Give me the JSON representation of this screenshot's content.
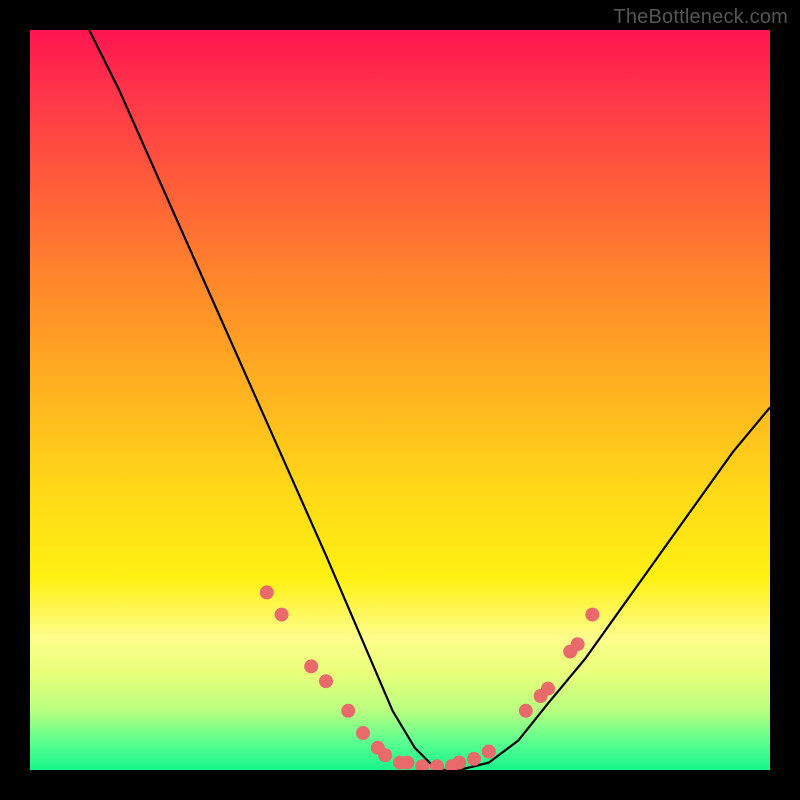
{
  "watermark": "TheBottleneck.com",
  "chart_data": {
    "type": "line",
    "title": "",
    "xlabel": "",
    "ylabel": "",
    "xlim": [
      0,
      100
    ],
    "ylim": [
      0,
      100
    ],
    "series": [
      {
        "name": "curve",
        "x": [
          8,
          12,
          16,
          20,
          24,
          28,
          32,
          36,
          40,
          43,
          46,
          49,
          52,
          55,
          58,
          62,
          66,
          70,
          75,
          80,
          85,
          90,
          95,
          100
        ],
        "y": [
          100,
          92,
          83,
          74,
          65,
          56,
          47,
          38,
          29,
          22,
          15,
          8,
          3,
          0,
          0,
          1,
          4,
          9,
          15,
          22,
          29,
          36,
          43,
          49
        ]
      }
    ],
    "markers": [
      {
        "x": 32,
        "y": 24
      },
      {
        "x": 34,
        "y": 21
      },
      {
        "x": 38,
        "y": 14
      },
      {
        "x": 40,
        "y": 12
      },
      {
        "x": 43,
        "y": 8
      },
      {
        "x": 45,
        "y": 5
      },
      {
        "x": 47,
        "y": 3
      },
      {
        "x": 48,
        "y": 2
      },
      {
        "x": 50,
        "y": 1
      },
      {
        "x": 51,
        "y": 1
      },
      {
        "x": 53,
        "y": 0.5
      },
      {
        "x": 55,
        "y": 0.5
      },
      {
        "x": 57,
        "y": 0.5
      },
      {
        "x": 58,
        "y": 1
      },
      {
        "x": 60,
        "y": 1.5
      },
      {
        "x": 62,
        "y": 2.5
      },
      {
        "x": 67,
        "y": 8
      },
      {
        "x": 69,
        "y": 10
      },
      {
        "x": 70,
        "y": 11
      },
      {
        "x": 73,
        "y": 16
      },
      {
        "x": 74,
        "y": 17
      },
      {
        "x": 76,
        "y": 21
      }
    ],
    "gradient_stops": [
      {
        "pos": 0,
        "color": "#ff1550"
      },
      {
        "pos": 10,
        "color": "#ff3a48"
      },
      {
        "pos": 22,
        "color": "#ff6038"
      },
      {
        "pos": 35,
        "color": "#ff8a2a"
      },
      {
        "pos": 48,
        "color": "#ffb020"
      },
      {
        "pos": 62,
        "color": "#ffd818"
      },
      {
        "pos": 74,
        "color": "#fff012"
      },
      {
        "pos": 82,
        "color": "#fdfd8b"
      },
      {
        "pos": 87,
        "color": "#e8ff7a"
      },
      {
        "pos": 92,
        "color": "#b8ff80"
      },
      {
        "pos": 96,
        "color": "#5fff90"
      },
      {
        "pos": 100,
        "color": "#18f58a"
      }
    ],
    "marker_color": "#e86a6a",
    "curve_color": "#000000"
  }
}
